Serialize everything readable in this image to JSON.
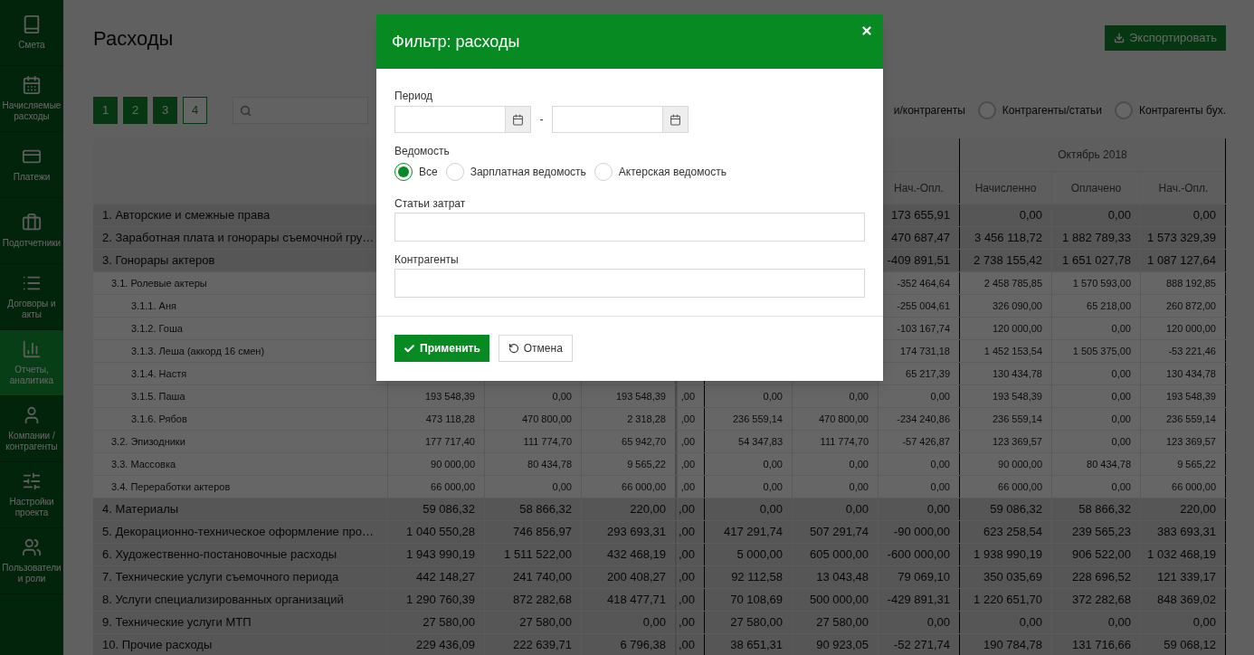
{
  "sidebar": {
    "items": [
      {
        "label": "Смета",
        "selected": false
      },
      {
        "label": "Начисляемые расходы",
        "selected": false
      },
      {
        "label": "Платежи",
        "selected": false
      },
      {
        "label": "Подотчетники",
        "selected": false
      },
      {
        "label": "Договоры и акты",
        "selected": false
      },
      {
        "label": "Отчеты, аналитика",
        "selected": true
      },
      {
        "label": "Компании / контрагенты",
        "selected": false
      },
      {
        "label": "Настройки проекта",
        "selected": false
      },
      {
        "label": "Пользователи и роли",
        "selected": false
      }
    ]
  },
  "page": {
    "title": "Расходы",
    "export_button": "Экспортировать"
  },
  "pagination": [
    {
      "label": "1",
      "selected": false
    },
    {
      "label": "2",
      "selected": false
    },
    {
      "label": "3",
      "selected": false
    },
    {
      "label": "4",
      "selected": true
    }
  ],
  "view_options": [
    {
      "label": "и/контрагенты",
      "kind": "cut"
    },
    {
      "label": "Контрагенты/статьи",
      "kind": "radio",
      "selected": false
    },
    {
      "label": "Контрагенты бух.",
      "kind": "radio",
      "selected": false
    }
  ],
  "table": {
    "group_header": "Октябрь 2018",
    "column_headers": [
      "Нач.-Опл.",
      "Начисленно",
      "Оплачено",
      "Нач.-Опл."
    ],
    "rows": [
      {
        "label": "1. Авторские и смежные права",
        "cells": [
          "173 655,91",
          "0,00",
          "0,00",
          "0,00"
        ]
      },
      {
        "label": "2. Заработная плата и гонорары съемочной гру…",
        "cells": [
          "470 687,47",
          "3 456 118,72",
          "1 882 789,33",
          "1 573 329,39"
        ]
      },
      {
        "label": "3. Гонорары актеров",
        "cells": [
          "-409 891,51",
          "2 738 155,42",
          "1 651 027,78",
          "1 087 127,64"
        ],
        "children": [
          {
            "label": "3.1. Ролевые актеры",
            "cells": [
              "-352 464,64",
              "2 458 785,85",
              "1 570 593,00",
              "888 192,85"
            ],
            "children": [
              {
                "label": "3.1.1. Аня",
                "cells": [
                  "-255 004,61",
                  "326 090,00",
                  "65 218,00",
                  "260 872,00"
                ]
              },
              {
                "label": "3.1.2. Гоша",
                "cells": [
                  "-103 167,74",
                  "120 000,00",
                  "0,00",
                  "120 000,00"
                ]
              },
              {
                "label": "3.1.3. Леша (аккорд 16 смен)",
                "cells": [
                  "174 731,18",
                  "1 452 153,54",
                  "1 505 375,00",
                  "-53 221,46"
                ]
              },
              {
                "label": "3.1.4. Настя",
                "cells": [
                  "65 217,39",
                  "130 434,78",
                  "0,00",
                  "130 434,78"
                ]
              },
              {
                "label": "3.1.5. Паша",
                "cells": [
                  "193 548,39",
                  "0,00",
                  "193 548,39",
                  ",00",
                  "0,00",
                  "0,00",
                  "0,00",
                  "193 548,39",
                  "0,00",
                  "193 548,39"
                ]
              },
              {
                "label": "3.1.6. Рябов",
                "cells": [
                  "473 118,28",
                  "470 800,00",
                  "2 318,28",
                  ",00",
                  "236 559,14",
                  "470 800,00",
                  "-234 240,86",
                  "236 559,14",
                  "0,00",
                  "236 559,14"
                ]
              }
            ]
          },
          {
            "label": "3.2. Эпизодники",
            "cells": [
              "177 717,40",
              "111 774,70",
              "65 942,70",
              ",00",
              "54 347,83",
              "111 774,70",
              "-57 426,87",
              "123 369,57",
              "0,00",
              "123 369,57"
            ]
          },
          {
            "label": "3.3. Массовка",
            "cells": [
              "90 000,00",
              "80 434,78",
              "9 565,22",
              ",00",
              "0,00",
              "0,00",
              "0,00",
              "90 000,00",
              "80 434,78",
              "9 565,22"
            ]
          },
          {
            "label": "3.4. Переработки актеров",
            "cells": [
              "66 000,00",
              "0,00",
              "66 000,00",
              ",00",
              "0,00",
              "0,00",
              "0,00",
              "66 000,00",
              "0,00",
              "66 000,00"
            ]
          }
        ]
      },
      {
        "label": "4. Материалы",
        "cells": [
          "59 086,32",
          "58 866,32",
          "220,00",
          ",00",
          "0,00",
          "0,00",
          "0,00",
          "59 086,32",
          "58 866,32",
          "220,00"
        ]
      },
      {
        "label": "5. Декорационно-техническое оформление про…",
        "cells": [
          "1 040 550,28",
          "746 856,97",
          "293 693,31",
          ",00",
          "417 291,74",
          "507 291,74",
          "-90 000,00",
          "623 258,54",
          "239 565,23",
          "383 693,31"
        ]
      },
      {
        "label": "6. Художественно-постановочные расходы",
        "cells": [
          "1 943 990,19",
          "1 511 522,00",
          "432 468,19",
          ",00",
          "5 000,00",
          "605 000,00",
          "-600 000,00",
          "1 938 990,19",
          "906 522,00",
          "1 032 468,19"
        ]
      },
      {
        "label": "7. Технические услуги съемочного периода",
        "cells": [
          "442 148,27",
          "241 740,00",
          "200 408,27",
          ",00",
          "92 112,58",
          "13 043,48",
          "79 069,10",
          "350 035,69",
          "228 696,52",
          "121 339,17"
        ]
      },
      {
        "label": "8. Услуги специализированных организаций",
        "cells": [
          "1 290 760,39",
          "872 282,68",
          "418 477,71",
          ",00",
          "70 108,69",
          "500 000,00",
          "-429 891,31",
          "1 220 651,70",
          "372 282,68",
          "848 369,02"
        ]
      },
      {
        "label": "9. Технические услуги МТП",
        "cells": [
          "27 580,00",
          "27 580,00",
          "0,00",
          ",00",
          "27 580,00",
          "27 580,00",
          "0,00",
          "0,00",
          "0,00",
          "0,00"
        ]
      },
      {
        "label": "10. Прочие расходы",
        "cells": [
          "229 436,09",
          "222 639,71",
          "6 796,38",
          ",00",
          "38 651,31",
          "90 923,05",
          "-52 271,74",
          "190 784,78",
          "131 716,66",
          "59 068,12"
        ]
      }
    ]
  },
  "modal": {
    "title": "Фильтр: расходы",
    "period": {
      "label": "Период",
      "separator": "-"
    },
    "statement": {
      "label": "Ведомость",
      "options": [
        {
          "label": "Все",
          "selected": true
        },
        {
          "label": "Зарплатная ведомость",
          "selected": false
        },
        {
          "label": "Актерская ведомость",
          "selected": false
        }
      ]
    },
    "fields": [
      {
        "label": "Статьи затрат"
      },
      {
        "label": "Контрагенты"
      }
    ],
    "buttons": [
      {
        "label": "Применить",
        "kind": "primary"
      },
      {
        "label": "Отмена",
        "kind": "secondary"
      }
    ]
  }
}
